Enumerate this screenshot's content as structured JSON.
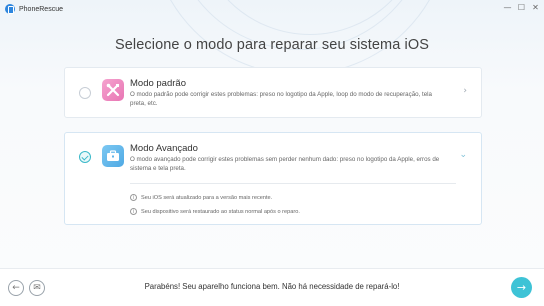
{
  "window": {
    "app_title": "PhoneRescue",
    "controls": {
      "minimize": "—",
      "maximize": "☐",
      "close": "✕"
    }
  },
  "page": {
    "title": "Selecione o modo para reparar seu sistema iOS"
  },
  "modes": {
    "standard": {
      "name": "Modo padrão",
      "description": "O modo padrão pode corrigir estes problemas: preso no logotipo da Apple, loop do modo de recuperação, tela preta, etc.",
      "icon": "tools-icon",
      "color": "#ec86c0"
    },
    "advanced": {
      "name": "Modo Avançado",
      "description": "O modo avançado pode corrigir estes problemas sem perder nenhum dado: preso no logotipo da Apple, erros de sistema e tela preta.",
      "icon": "toolbox-icon",
      "color": "#5fb4ea",
      "selected": true,
      "notes": [
        "Seu iOS será atualizado para a versão mais recente.",
        "Seu dispositivo será restaurado ao status normal após o reparo."
      ]
    }
  },
  "footer": {
    "status": "Parabéns! Seu aparelho funciona bem. Não há necessidade de repará-lo!",
    "accent_color": "#3ec3d6"
  }
}
